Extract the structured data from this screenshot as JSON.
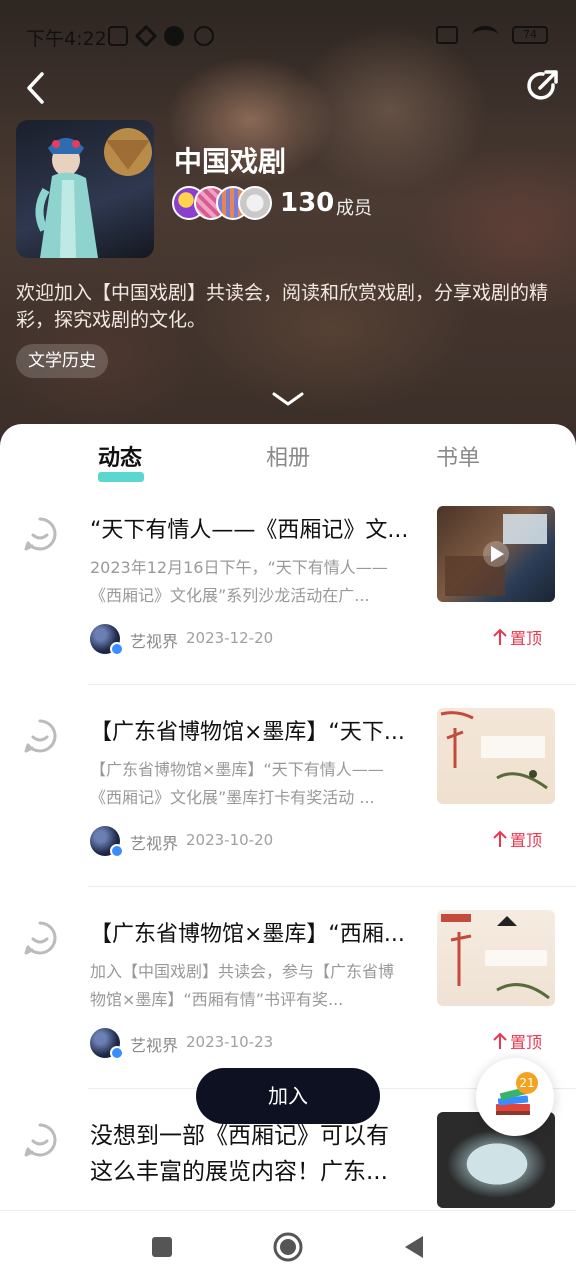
{
  "status_bar": {
    "time": "下午4:22",
    "battery": "74"
  },
  "group": {
    "title": "中国戏剧",
    "member_count": "130",
    "member_label": "成员",
    "description": "欢迎加入【中国戏剧】共读会，阅读和欣赏戏剧，分享戏剧的精彩，探究戏剧的文化。",
    "tag": "文学历史"
  },
  "tabs": [
    {
      "label": "动态",
      "active": true
    },
    {
      "label": "相册",
      "active": false
    },
    {
      "label": "书单",
      "active": false
    }
  ],
  "posts": [
    {
      "title": "“天下有情人——《西厢记》文...",
      "excerpt": "2023年12月16日下午，“天下有情人——《西厢记》文化展”系列沙龙活动在广...",
      "author": "艺视界",
      "date": "2023-12-20",
      "pin_label": "置顶"
    },
    {
      "title": "【广东省博物馆×墨库】“天下...",
      "excerpt": "【广东省博物馆×墨库】“天下有情人——《西厢记》文化展”墨库打卡有奖活动 ...",
      "author": "艺视界",
      "date": "2023-10-20",
      "pin_label": "置顶"
    },
    {
      "title": "【广东省博物馆×墨库】“西厢...",
      "excerpt": "加入【中国戏剧】共读会，参与【广东省博物馆×墨库】“西厢有情”书评有奖...",
      "author": "艺视界",
      "date": "2023-10-23",
      "pin_label": "置顶"
    },
    {
      "title": "没想到一部《西厢记》可以有这么丰富的展览内容！广东..."
    }
  ],
  "join_button": "加入",
  "fab_badge": "21",
  "accent_colors": {
    "tab_indicator": "#3ed0c8",
    "pin": "#e8384f",
    "join_button": "#0e1122"
  }
}
